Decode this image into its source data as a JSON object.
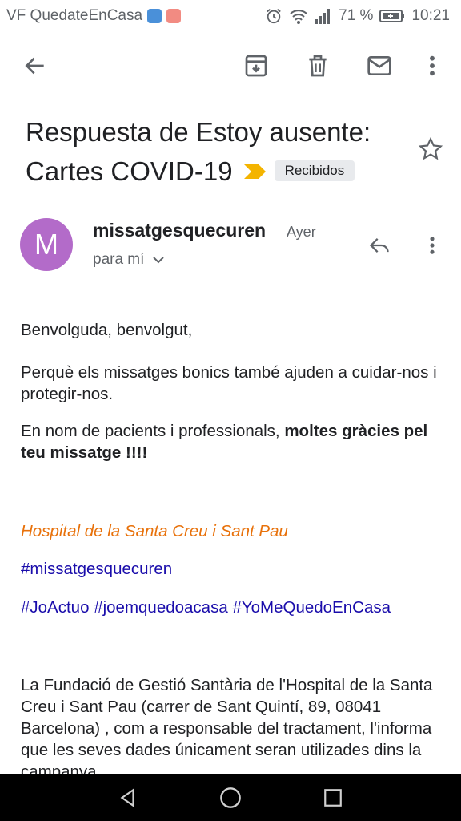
{
  "status_bar": {
    "carrier": "VF QuedateEnCasa",
    "battery": "71 %",
    "time": "10:21",
    "icons": [
      "shield-icon",
      "mail-notification-icon",
      "alarm-icon",
      "wifi-icon",
      "signal-icon",
      "battery-icon"
    ]
  },
  "toolbar": {
    "actions": [
      "back-arrow-icon",
      "archive-icon",
      "delete-icon",
      "mark-unread-icon",
      "more-vert-icon"
    ]
  },
  "email": {
    "subject": "Respuesta de Estoy ausente: Cartes COVID-19",
    "label": "Recibidos",
    "importance_color": "#f4b400",
    "sender_initial": "M",
    "avatar_color": "#b36bc9",
    "sender": "missatgesquecuren",
    "date": "Ayer",
    "recipient": "para mí"
  },
  "body": {
    "greeting": "Benvolguda, benvolgut,",
    "p1": "Perquè els missatges bonics també ajuden a cuidar-nos i protegir-nos.",
    "p2_plain": "En nom de pacients i professionals, ",
    "p2_bold": "moltes gràcies pel teu missatge !!!!",
    "hospital": "Hospital de la Santa Creu i Sant Pau",
    "hashtag1": "#missatgesquecuren",
    "hashtag2": "#JoActuo",
    "hashtag3": "#joemquedoacasa",
    "hashtag4": "#YoMeQuedoEnCasa",
    "legal": "La Fundació de Gestió Santària de l'Hospital de la Santa Creu i Sant Pau (carrer de Sant Quintí, 89, 08041 Barcelona) , com a responsable del tractament, l'informa que les seves dades únicament seran utilizades dins la campanya"
  },
  "navbar": {
    "buttons": [
      "back-triangle-icon",
      "home-circle-icon",
      "recents-square-icon"
    ]
  }
}
